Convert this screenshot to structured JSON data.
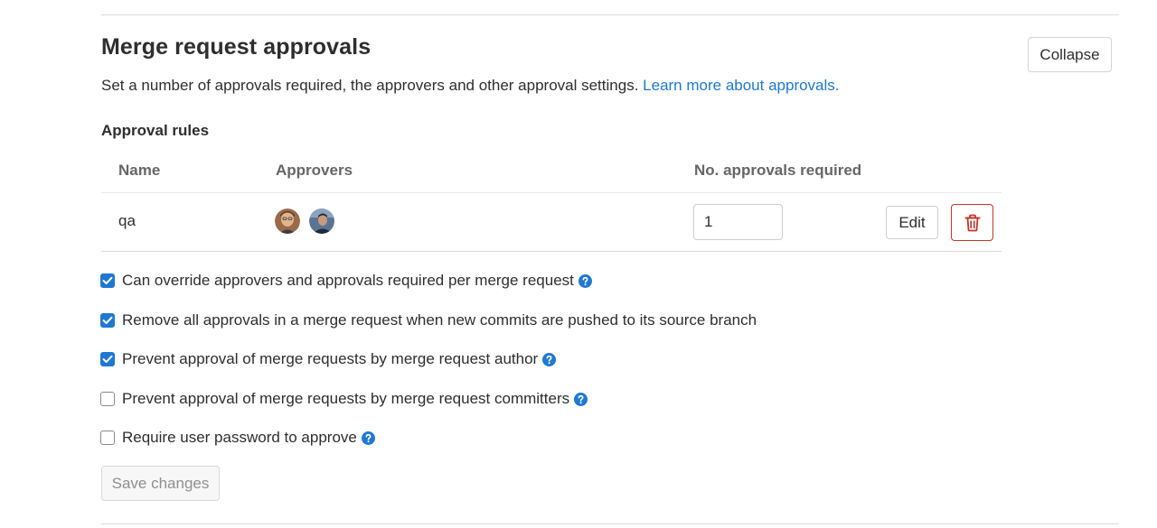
{
  "section": {
    "title": "Merge request approvals",
    "collapse_label": "Collapse",
    "description": "Set a number of approvals required, the approvers and other approval settings.",
    "learn_more_link": "Learn more about approvals."
  },
  "rules": {
    "heading": "Approval rules",
    "columns": {
      "name": "Name",
      "approvers": "Approvers",
      "required": "No. approvals required"
    },
    "rows": [
      {
        "name": "qa",
        "approvers": [
          "avatar",
          "avatar"
        ],
        "approvals_required": "1",
        "edit_label": "Edit",
        "delete_icon": "trash-icon"
      }
    ]
  },
  "settings": [
    {
      "label": "Can override approvers and approvals required per merge request",
      "checked": true,
      "help": true
    },
    {
      "label": "Remove all approvals in a merge request when new commits are pushed to its source branch",
      "checked": true,
      "help": false
    },
    {
      "label": "Prevent approval of merge requests by merge request author",
      "checked": true,
      "help": true
    },
    {
      "label": "Prevent approval of merge requests by merge request committers",
      "checked": false,
      "help": true
    },
    {
      "label": "Require user password to approve",
      "checked": false,
      "help": true
    }
  ],
  "save_label": "Save changes",
  "colors": {
    "accent": "#1f78d1",
    "danger": "#c0362c",
    "text": "#2e2e2e",
    "muted_header": "#666666"
  }
}
